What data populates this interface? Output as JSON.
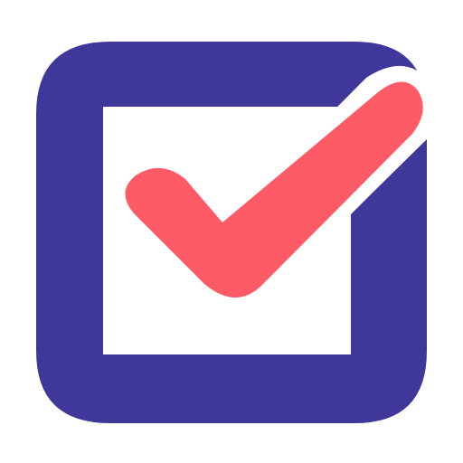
{
  "icon": {
    "name": "checkbox-checked-icon",
    "colors": {
      "background": "#ffffff",
      "frame": "#3f389a",
      "inner": "#ffffff",
      "check": "#ff5b66"
    }
  }
}
